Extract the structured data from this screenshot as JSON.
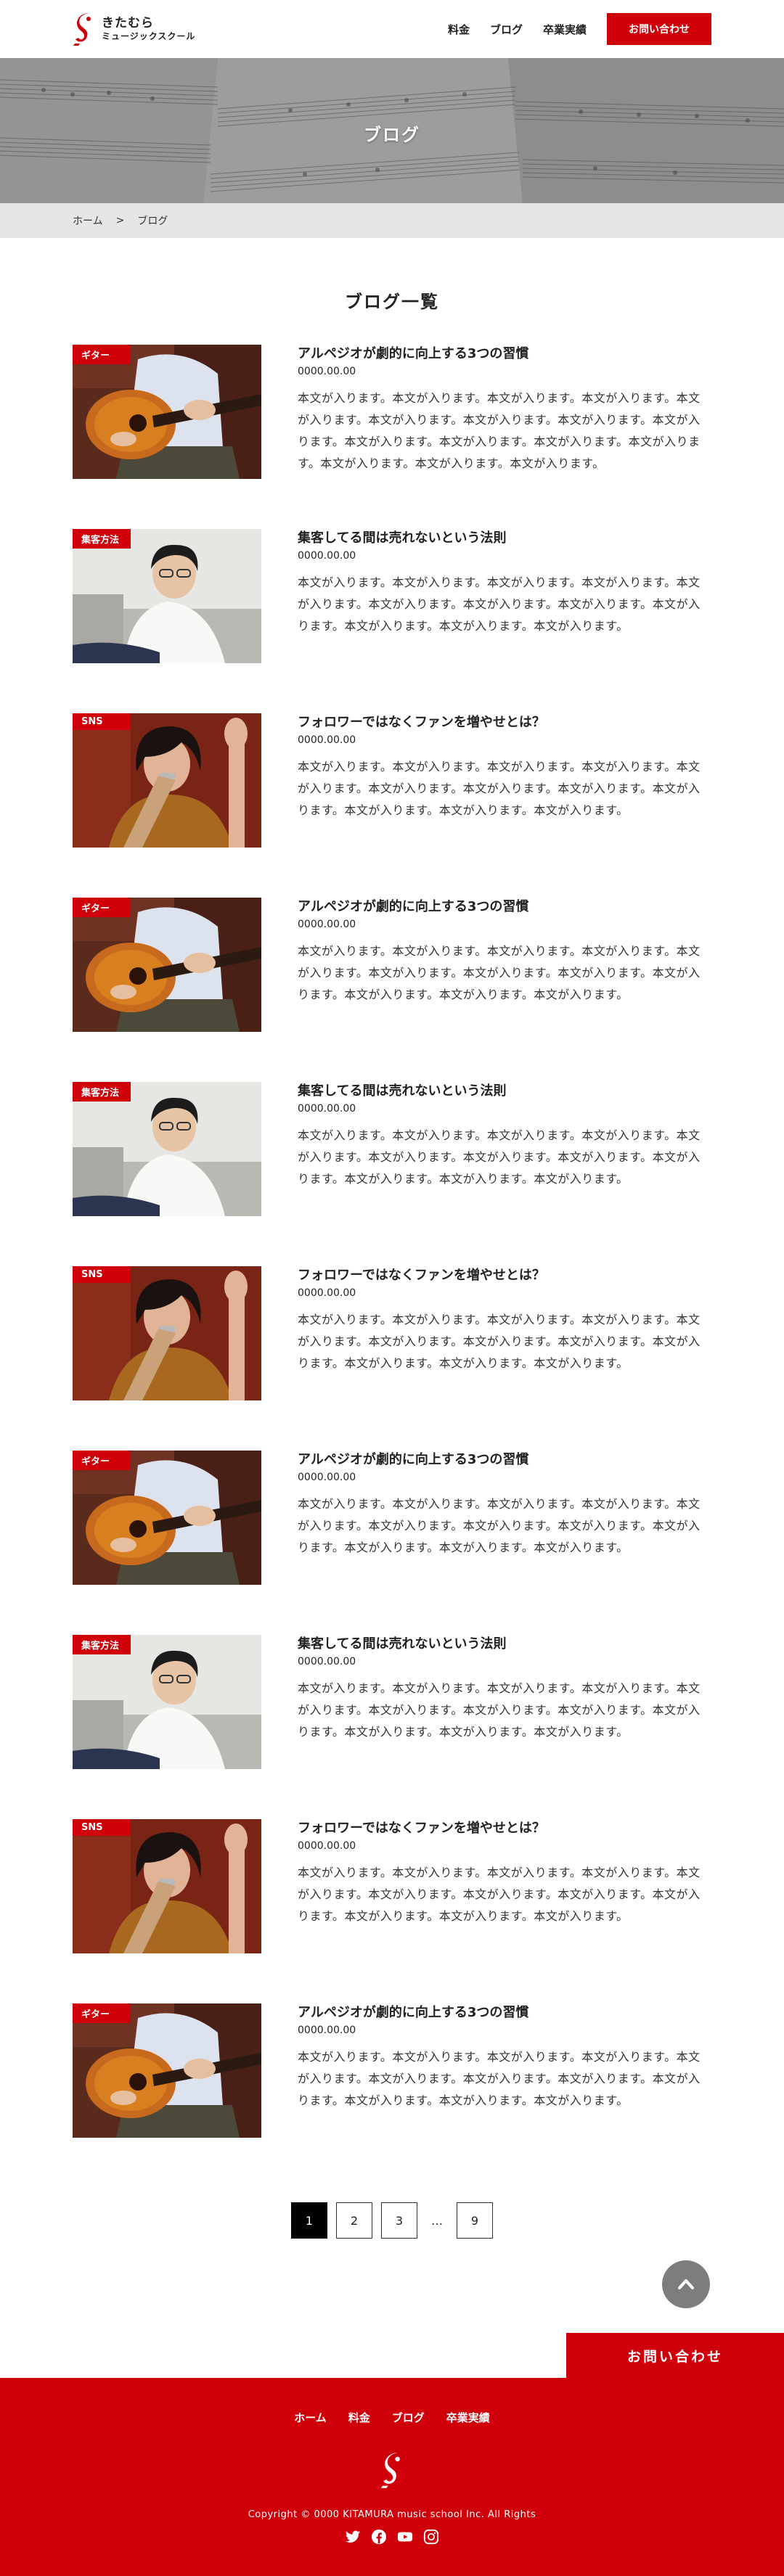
{
  "header": {
    "logo_name": "きたむら",
    "logo_sub": "ミュージックスクール",
    "nav": [
      "料金",
      "ブログ",
      "卒業実績"
    ],
    "contact_label": "お問い合わせ"
  },
  "hero": {
    "title": "ブログ"
  },
  "breadcrumb": {
    "home": "ホーム",
    "separator": ">",
    "current": "ブログ"
  },
  "section_title": "ブログ一覧",
  "posts": [
    {
      "tag": "ギター",
      "title": "アルペジオが劇的に向上する3つの習慣",
      "date": "0000.00.00",
      "image": "guitar-player",
      "excerpt": "本文が入ります。本文が入ります。本文が入ります。本文が入ります。本文が入ります。本文が入ります。本文が入ります。本文が入ります。本文が入ります。本文が入ります。本文が入ります。本文が入ります。本文が入ります。本文が入ります。本文が入ります。本文が入ります。"
    },
    {
      "tag": "集客方法",
      "title": "集客してる間は売れないという法則",
      "date": "0000.00.00",
      "image": "man-on-sofa",
      "excerpt": "本文が入ります。本文が入ります。本文が入ります。本文が入ります。本文が入ります。本文が入ります。本文が入ります。本文が入ります。本文が入ります。本文が入ります。本文が入ります。本文が入ります。"
    },
    {
      "tag": "SNS",
      "title": "フォロワーではなくファンを増やせとは？",
      "date": "0000.00.00",
      "image": "singer-microphone",
      "excerpt": "本文が入ります。本文が入ります。本文が入ります。本文が入ります。本文が入ります。本文が入ります。本文が入ります。本文が入ります。本文が入ります。本文が入ります。本文が入ります。本文が入ります。"
    },
    {
      "tag": "ギター",
      "title": "アルペジオが劇的に向上する3つの習慣",
      "date": "0000.00.00",
      "image": "guitar-player",
      "excerpt": "本文が入ります。本文が入ります。本文が入ります。本文が入ります。本文が入ります。本文が入ります。本文が入ります。本文が入ります。本文が入ります。本文が入ります。本文が入ります。本文が入ります。"
    },
    {
      "tag": "集客方法",
      "title": "集客してる間は売れないという法則",
      "date": "0000.00.00",
      "image": "man-on-sofa",
      "excerpt": "本文が入ります。本文が入ります。本文が入ります。本文が入ります。本文が入ります。本文が入ります。本文が入ります。本文が入ります。本文が入ります。本文が入ります。本文が入ります。本文が入ります。"
    },
    {
      "tag": "SNS",
      "title": "フォロワーではなくファンを増やせとは？",
      "date": "0000.00.00",
      "image": "singer-microphone",
      "excerpt": "本文が入ります。本文が入ります。本文が入ります。本文が入ります。本文が入ります。本文が入ります。本文が入ります。本文が入ります。本文が入ります。本文が入ります。本文が入ります。本文が入ります。"
    },
    {
      "tag": "ギター",
      "title": "アルペジオが劇的に向上する3つの習慣",
      "date": "0000.00.00",
      "image": "guitar-player",
      "excerpt": "本文が入ります。本文が入ります。本文が入ります。本文が入ります。本文が入ります。本文が入ります。本文が入ります。本文が入ります。本文が入ります。本文が入ります。本文が入ります。本文が入ります。"
    },
    {
      "tag": "集客方法",
      "title": "集客してる間は売れないという法則",
      "date": "0000.00.00",
      "image": "man-on-sofa",
      "excerpt": "本文が入ります。本文が入ります。本文が入ります。本文が入ります。本文が入ります。本文が入ります。本文が入ります。本文が入ります。本文が入ります。本文が入ります。本文が入ります。本文が入ります。"
    },
    {
      "tag": "SNS",
      "title": "フォロワーではなくファンを増やせとは？",
      "date": "0000.00.00",
      "image": "singer-microphone",
      "excerpt": "本文が入ります。本文が入ります。本文が入ります。本文が入ります。本文が入ります。本文が入ります。本文が入ります。本文が入ります。本文が入ります。本文が入ります。本文が入ります。本文が入ります。"
    },
    {
      "tag": "ギター",
      "title": "アルペジオが劇的に向上する3つの習慣",
      "date": "0000.00.00",
      "image": "guitar-player",
      "excerpt": "本文が入ります。本文が入ります。本文が入ります。本文が入ります。本文が入ります。本文が入ります。本文が入ります。本文が入ります。本文が入ります。本文が入ります。本文が入ります。本文が入ります。"
    }
  ],
  "pagination": {
    "pages": [
      "1",
      "2",
      "3"
    ],
    "ellipsis": "…",
    "last": "9",
    "current": "1"
  },
  "footer": {
    "contact_label": "お問い合わせ",
    "nav": [
      "ホーム",
      "料金",
      "ブログ",
      "卒業実績"
    ],
    "copyright": "Copyright © 0000 KITAMURA music school Inc. All Rights",
    "social": [
      "twitter-icon",
      "facebook-icon",
      "youtube-icon",
      "instagram-icon"
    ]
  },
  "colors": {
    "brand": "#d0000b",
    "breadcrumb_bg": "#e6e6e6",
    "pagetop": "#7d7d7d"
  }
}
